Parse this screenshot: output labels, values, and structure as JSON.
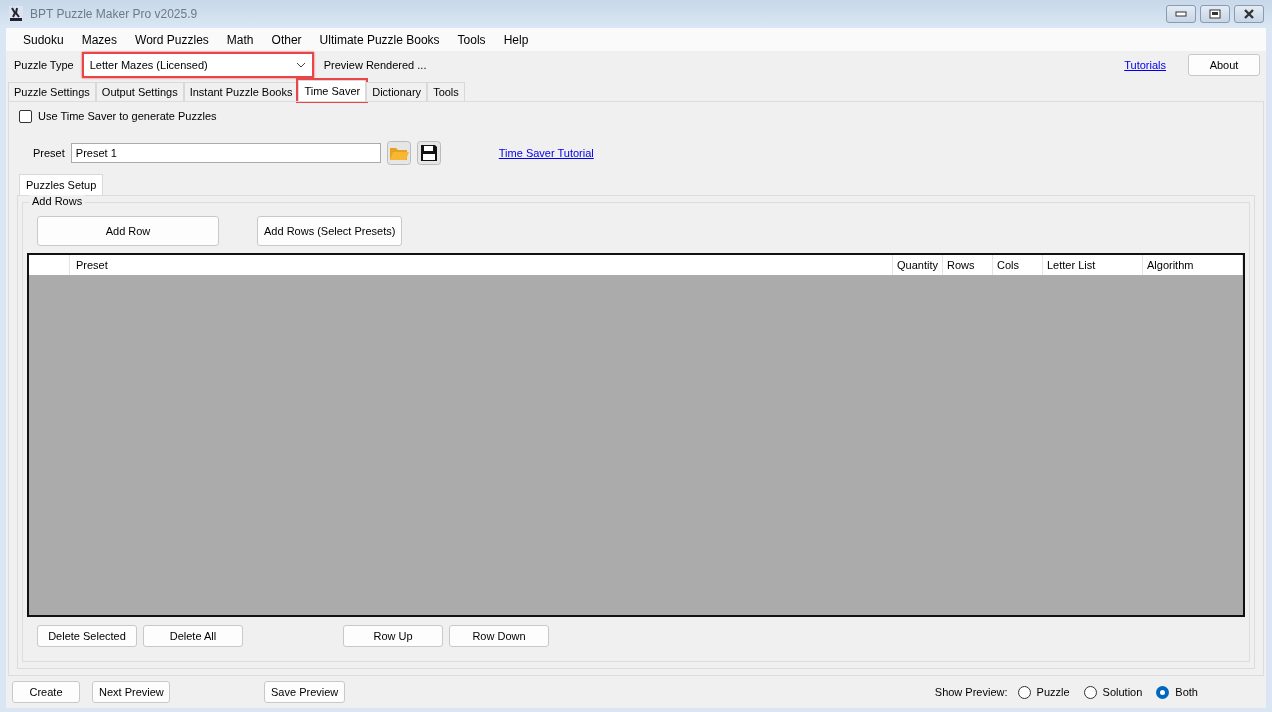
{
  "window": {
    "title": "BPT Puzzle Maker Pro v2025.9"
  },
  "menu": [
    "Sudoku",
    "Mazes",
    "Word Puzzles",
    "Math",
    "Other",
    "Ultimate Puzzle Books",
    "Tools",
    "Help"
  ],
  "toolbar": {
    "puzzle_type_label": "Puzzle Type",
    "puzzle_type": {
      "value": "Letter Mazes (Licensed)",
      "highlighted": true
    },
    "status": "Preview Rendered ...",
    "tutorials_link": "Tutorials",
    "about_button": "About"
  },
  "tabs": [
    {
      "label": "Puzzle Settings",
      "selected": false,
      "highlighted": false
    },
    {
      "label": "Output Settings",
      "selected": false,
      "highlighted": false
    },
    {
      "label": "Instant Puzzle Books",
      "selected": false,
      "highlighted": false
    },
    {
      "label": "Time Saver",
      "selected": true,
      "highlighted": true
    },
    {
      "label": "Dictionary",
      "selected": false,
      "highlighted": false
    },
    {
      "label": "Tools",
      "selected": false,
      "highlighted": false
    }
  ],
  "time_saver": {
    "use_checkbox": {
      "label": "Use Time Saver to generate Puzzles",
      "checked": false
    },
    "preset_label": "Preset",
    "preset_value": "Preset 1",
    "tutorial_link": "Time Saver Tutorial",
    "inner_tabs": [
      {
        "label": "Puzzles Setup",
        "selected": true
      }
    ],
    "add_rows": {
      "title": "Add Rows",
      "buttons": [
        "Add Row",
        "Add Rows (Select Presets)"
      ]
    },
    "table": {
      "columns": [
        "Preset",
        "Quantity",
        "Rows",
        "Cols",
        "Letter List",
        "Algorithm"
      ]
    },
    "row_buttons": [
      "Delete Selected",
      "Delete All",
      "Row Up",
      "Row Down"
    ]
  },
  "bottom": {
    "buttons": [
      "Create",
      "Next Preview",
      "Save Preview"
    ],
    "show_preview_label": "Show Preview:",
    "preview_options": [
      {
        "label": "Puzzle",
        "selected": false
      },
      {
        "label": "Solution",
        "selected": false
      },
      {
        "label": "Both",
        "selected": true
      }
    ]
  }
}
